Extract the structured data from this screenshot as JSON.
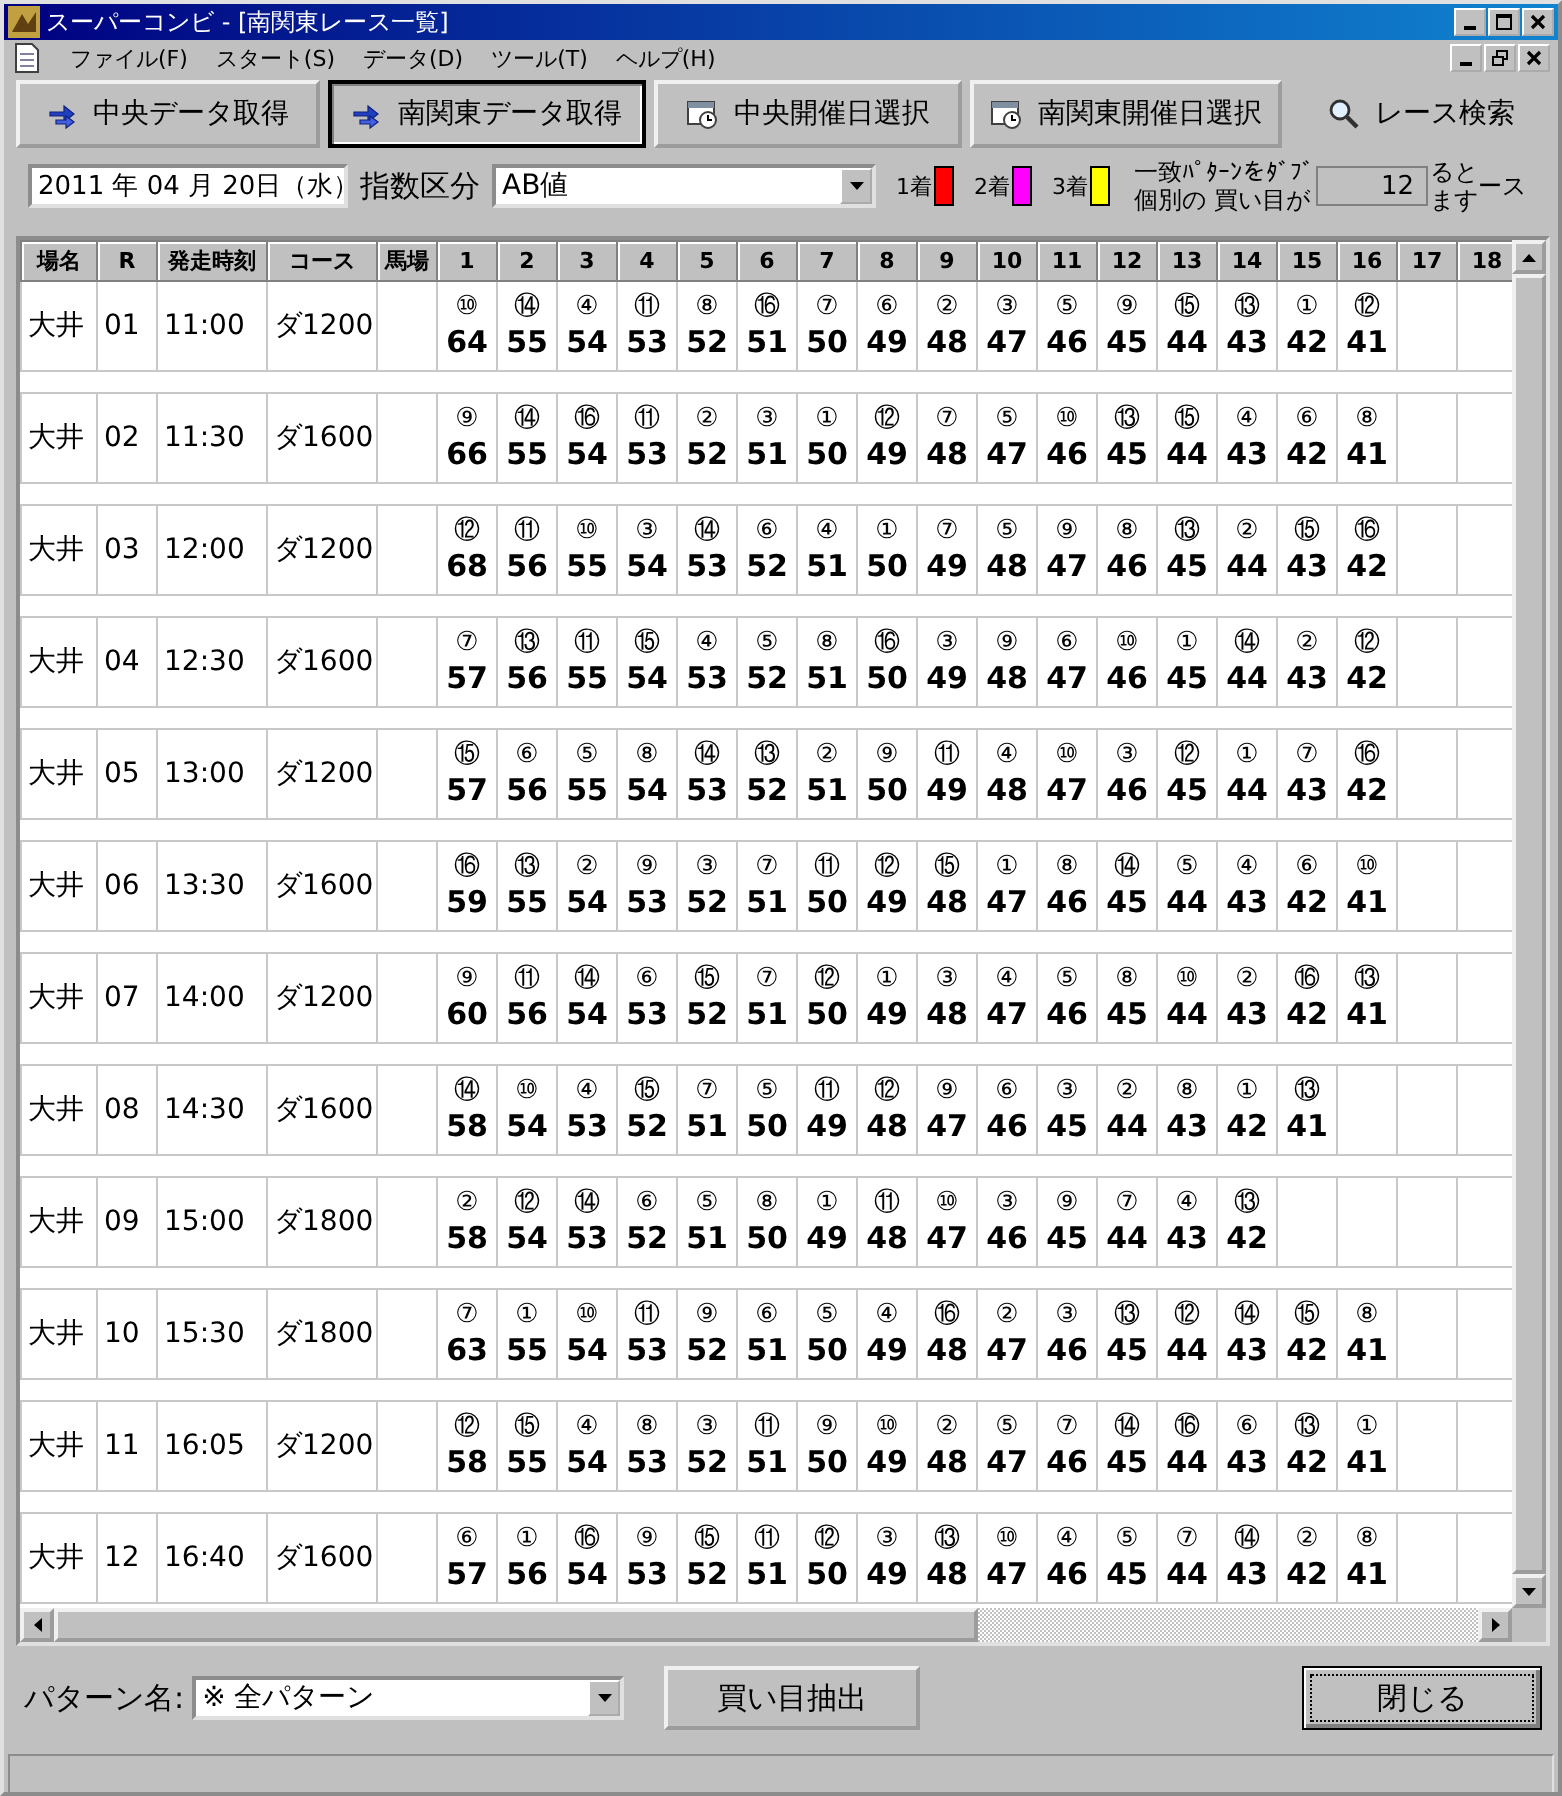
{
  "window": {
    "title": "スーパーコンビ - [南関東レース一覧]"
  },
  "menu": [
    "ファイル(F)",
    "スタート(S)",
    "データ(D)",
    "ツール(T)",
    "ヘルプ(H)"
  ],
  "toolbar": [
    {
      "label": "中央データ取得",
      "kind": "download",
      "selected": false
    },
    {
      "label": "南関東データ取得",
      "kind": "download",
      "selected": true
    },
    {
      "label": "中央開催日選択",
      "kind": "calendar",
      "selected": false
    },
    {
      "label": "南関東開催日選択",
      "kind": "calendar",
      "selected": false
    },
    {
      "label": "レース検索",
      "kind": "search",
      "selected": false
    }
  ],
  "filters": {
    "date": "2011 年 04 月 20日（水）",
    "index_label": "指数区分",
    "index_value": "AB値"
  },
  "legend": [
    {
      "label": "1着",
      "color": "#ff0000"
    },
    {
      "label": "2着",
      "color": "#ff00ff"
    },
    {
      "label": "3着",
      "color": "#ffff00"
    }
  ],
  "notice": {
    "line_1": "一致ﾊﾟﾀｰﾝをﾀﾞﾌﾞ",
    "line_1_end": "ると",
    "line_2": "個別の 買い目が",
    "line_2_end": "ます",
    "count": "12",
    "trailing": "ース"
  },
  "table": {
    "columns": [
      "場名",
      "R",
      "発走時刻",
      "コース",
      "馬場",
      "1",
      "2",
      "3",
      "4",
      "5",
      "6",
      "7",
      "8",
      "9",
      "10",
      "11",
      "12",
      "13",
      "14",
      "15",
      "16",
      "17",
      "18"
    ],
    "rows": [
      {
        "venue": "大井",
        "race": "01",
        "time": "11:00",
        "course": "ダ1200",
        "entries": [
          [
            "⑩",
            "64"
          ],
          [
            "⑭",
            "55"
          ],
          [
            "④",
            "54"
          ],
          [
            "⑪",
            "53"
          ],
          [
            "⑧",
            "52"
          ],
          [
            "⑯",
            "51"
          ],
          [
            "⑦",
            "50"
          ],
          [
            "⑥",
            "49"
          ],
          [
            "②",
            "48"
          ],
          [
            "③",
            "47"
          ],
          [
            "⑤",
            "46"
          ],
          [
            "⑨",
            "45"
          ],
          [
            "⑮",
            "44"
          ],
          [
            "⑬",
            "43"
          ],
          [
            "①",
            "42"
          ],
          [
            "⑫",
            "41"
          ]
        ]
      },
      {
        "venue": "大井",
        "race": "02",
        "time": "11:30",
        "course": "ダ1600",
        "entries": [
          [
            "⑨",
            "66"
          ],
          [
            "⑭",
            "55"
          ],
          [
            "⑯",
            "54"
          ],
          [
            "⑪",
            "53"
          ],
          [
            "②",
            "52"
          ],
          [
            "③",
            "51"
          ],
          [
            "①",
            "50"
          ],
          [
            "⑫",
            "49"
          ],
          [
            "⑦",
            "48"
          ],
          [
            "⑤",
            "47"
          ],
          [
            "⑩",
            "46"
          ],
          [
            "⑬",
            "45"
          ],
          [
            "⑮",
            "44"
          ],
          [
            "④",
            "43"
          ],
          [
            "⑥",
            "42"
          ],
          [
            "⑧",
            "41"
          ]
        ]
      },
      {
        "venue": "大井",
        "race": "03",
        "time": "12:00",
        "course": "ダ1200",
        "entries": [
          [
            "⑫",
            "68"
          ],
          [
            "⑪",
            "56"
          ],
          [
            "⑩",
            "55"
          ],
          [
            "③",
            "54"
          ],
          [
            "⑭",
            "53"
          ],
          [
            "⑥",
            "52"
          ],
          [
            "④",
            "51"
          ],
          [
            "①",
            "50"
          ],
          [
            "⑦",
            "49"
          ],
          [
            "⑤",
            "48"
          ],
          [
            "⑨",
            "47"
          ],
          [
            "⑧",
            "46"
          ],
          [
            "⑬",
            "45"
          ],
          [
            "②",
            "44"
          ],
          [
            "⑮",
            "43"
          ],
          [
            "⑯",
            "42"
          ]
        ]
      },
      {
        "venue": "大井",
        "race": "04",
        "time": "12:30",
        "course": "ダ1600",
        "entries": [
          [
            "⑦",
            "57"
          ],
          [
            "⑬",
            "56"
          ],
          [
            "⑪",
            "55"
          ],
          [
            "⑮",
            "54"
          ],
          [
            "④",
            "53"
          ],
          [
            "⑤",
            "52"
          ],
          [
            "⑧",
            "51"
          ],
          [
            "⑯",
            "50"
          ],
          [
            "③",
            "49"
          ],
          [
            "⑨",
            "48"
          ],
          [
            "⑥",
            "47"
          ],
          [
            "⑩",
            "46"
          ],
          [
            "①",
            "45"
          ],
          [
            "⑭",
            "44"
          ],
          [
            "②",
            "43"
          ],
          [
            "⑫",
            "42"
          ]
        ]
      },
      {
        "venue": "大井",
        "race": "05",
        "time": "13:00",
        "course": "ダ1200",
        "entries": [
          [
            "⑮",
            "57"
          ],
          [
            "⑥",
            "56"
          ],
          [
            "⑤",
            "55"
          ],
          [
            "⑧",
            "54"
          ],
          [
            "⑭",
            "53"
          ],
          [
            "⑬",
            "52"
          ],
          [
            "②",
            "51"
          ],
          [
            "⑨",
            "50"
          ],
          [
            "⑪",
            "49"
          ],
          [
            "④",
            "48"
          ],
          [
            "⑩",
            "47"
          ],
          [
            "③",
            "46"
          ],
          [
            "⑫",
            "45"
          ],
          [
            "①",
            "44"
          ],
          [
            "⑦",
            "43"
          ],
          [
            "⑯",
            "42"
          ]
        ]
      },
      {
        "venue": "大井",
        "race": "06",
        "time": "13:30",
        "course": "ダ1600",
        "entries": [
          [
            "⑯",
            "59"
          ],
          [
            "⑬",
            "55"
          ],
          [
            "②",
            "54"
          ],
          [
            "⑨",
            "53"
          ],
          [
            "③",
            "52"
          ],
          [
            "⑦",
            "51"
          ],
          [
            "⑪",
            "50"
          ],
          [
            "⑫",
            "49"
          ],
          [
            "⑮",
            "48"
          ],
          [
            "①",
            "47"
          ],
          [
            "⑧",
            "46"
          ],
          [
            "⑭",
            "45"
          ],
          [
            "⑤",
            "44"
          ],
          [
            "④",
            "43"
          ],
          [
            "⑥",
            "42"
          ],
          [
            "⑩",
            "41"
          ]
        ]
      },
      {
        "venue": "大井",
        "race": "07",
        "time": "14:00",
        "course": "ダ1200",
        "entries": [
          [
            "⑨",
            "60"
          ],
          [
            "⑪",
            "56"
          ],
          [
            "⑭",
            "54"
          ],
          [
            "⑥",
            "53"
          ],
          [
            "⑮",
            "52"
          ],
          [
            "⑦",
            "51"
          ],
          [
            "⑫",
            "50"
          ],
          [
            "①",
            "49"
          ],
          [
            "③",
            "48"
          ],
          [
            "④",
            "47"
          ],
          [
            "⑤",
            "46"
          ],
          [
            "⑧",
            "45"
          ],
          [
            "⑩",
            "44"
          ],
          [
            "②",
            "43"
          ],
          [
            "⑯",
            "42"
          ],
          [
            "⑬",
            "41"
          ]
        ]
      },
      {
        "venue": "大井",
        "race": "08",
        "time": "14:30",
        "course": "ダ1600",
        "entries": [
          [
            "⑭",
            "58"
          ],
          [
            "⑩",
            "54"
          ],
          [
            "④",
            "53"
          ],
          [
            "⑮",
            "52"
          ],
          [
            "⑦",
            "51"
          ],
          [
            "⑤",
            "50"
          ],
          [
            "⑪",
            "49"
          ],
          [
            "⑫",
            "48"
          ],
          [
            "⑨",
            "47"
          ],
          [
            "⑥",
            "46"
          ],
          [
            "③",
            "45"
          ],
          [
            "②",
            "44"
          ],
          [
            "⑧",
            "43"
          ],
          [
            "①",
            "42"
          ],
          [
            "⑬",
            "41"
          ]
        ]
      },
      {
        "venue": "大井",
        "race": "09",
        "time": "15:00",
        "course": "ダ1800",
        "entries": [
          [
            "②",
            "58"
          ],
          [
            "⑫",
            "54"
          ],
          [
            "⑭",
            "53"
          ],
          [
            "⑥",
            "52"
          ],
          [
            "⑤",
            "51"
          ],
          [
            "⑧",
            "50"
          ],
          [
            "①",
            "49"
          ],
          [
            "⑪",
            "48"
          ],
          [
            "⑩",
            "47"
          ],
          [
            "③",
            "46"
          ],
          [
            "⑨",
            "45"
          ],
          [
            "⑦",
            "44"
          ],
          [
            "④",
            "43"
          ],
          [
            "⑬",
            "42"
          ]
        ]
      },
      {
        "venue": "大井",
        "race": "10",
        "time": "15:30",
        "course": "ダ1800",
        "entries": [
          [
            "⑦",
            "63"
          ],
          [
            "①",
            "55"
          ],
          [
            "⑩",
            "54"
          ],
          [
            "⑪",
            "53"
          ],
          [
            "⑨",
            "52"
          ],
          [
            "⑥",
            "51"
          ],
          [
            "⑤",
            "50"
          ],
          [
            "④",
            "49"
          ],
          [
            "⑯",
            "48"
          ],
          [
            "②",
            "47"
          ],
          [
            "③",
            "46"
          ],
          [
            "⑬",
            "45"
          ],
          [
            "⑫",
            "44"
          ],
          [
            "⑭",
            "43"
          ],
          [
            "⑮",
            "42"
          ],
          [
            "⑧",
            "41"
          ]
        ]
      },
      {
        "venue": "大井",
        "race": "11",
        "time": "16:05",
        "course": "ダ1200",
        "entries": [
          [
            "⑫",
            "58"
          ],
          [
            "⑮",
            "55"
          ],
          [
            "④",
            "54"
          ],
          [
            "⑧",
            "53"
          ],
          [
            "③",
            "52"
          ],
          [
            "⑪",
            "51"
          ],
          [
            "⑨",
            "50"
          ],
          [
            "⑩",
            "49"
          ],
          [
            "②",
            "48"
          ],
          [
            "⑤",
            "47"
          ],
          [
            "⑦",
            "46"
          ],
          [
            "⑭",
            "45"
          ],
          [
            "⑯",
            "44"
          ],
          [
            "⑥",
            "43"
          ],
          [
            "⑬",
            "42"
          ],
          [
            "①",
            "41"
          ]
        ]
      },
      {
        "venue": "大井",
        "race": "12",
        "time": "16:40",
        "course": "ダ1600",
        "entries": [
          [
            "⑥",
            "57"
          ],
          [
            "①",
            "56"
          ],
          [
            "⑯",
            "54"
          ],
          [
            "⑨",
            "53"
          ],
          [
            "⑮",
            "52"
          ],
          [
            "⑪",
            "51"
          ],
          [
            "⑫",
            "50"
          ],
          [
            "③",
            "49"
          ],
          [
            "⑬",
            "48"
          ],
          [
            "⑩",
            "47"
          ],
          [
            "④",
            "46"
          ],
          [
            "⑤",
            "45"
          ],
          [
            "⑦",
            "44"
          ],
          [
            "⑭",
            "43"
          ],
          [
            "②",
            "42"
          ],
          [
            "⑧",
            "41"
          ]
        ]
      }
    ]
  },
  "bottom": {
    "pattern_label": "パターン名:",
    "pattern_value": "※ 全パターン",
    "extract_button": "買い目抽出",
    "close_button": "閉じる"
  }
}
